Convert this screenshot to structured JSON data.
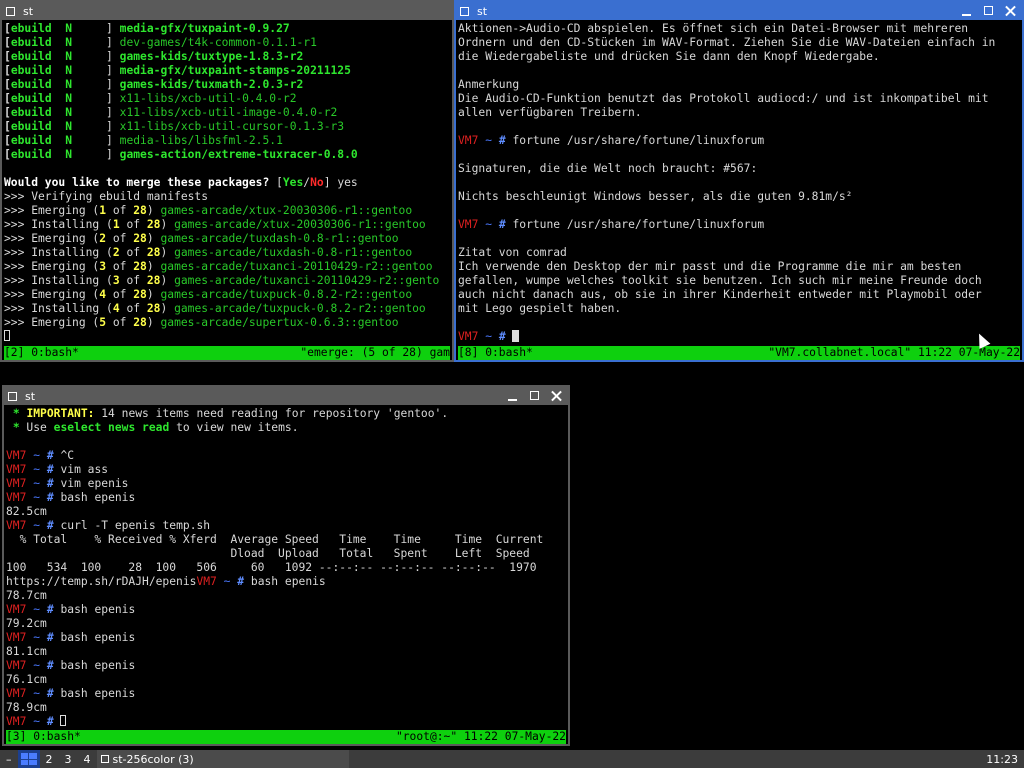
{
  "windows": {
    "emerge": {
      "title": "st",
      "status_left": "[2] 0:bash*",
      "status_right": "\"emerge: (5 of 28) gam"
    },
    "fortune": {
      "title": "st",
      "status_left": "[8] 0:bash*",
      "status_right": "\"VM7.collabnet.local\" 11:22 07-May-22"
    },
    "curl": {
      "title": "st",
      "status_left": "[3] 0:bash*",
      "status_right": "\"root@:~\" 11:22 07-May-22"
    }
  },
  "emerge_lines": [
    {
      "t": "ebuild",
      "f": "N",
      "pkg": "media-gfx/tuxpaint-0.9.27",
      "bold": true
    },
    {
      "t": "ebuild",
      "f": "N",
      "pkg": "dev-games/t4k-common-0.1.1-r1",
      "bold": false
    },
    {
      "t": "ebuild",
      "f": "N",
      "pkg": "games-kids/tuxtype-1.8.3-r2",
      "bold": true
    },
    {
      "t": "ebuild",
      "f": "N",
      "pkg": "media-gfx/tuxpaint-stamps-20211125",
      "bold": true
    },
    {
      "t": "ebuild",
      "f": "N",
      "pkg": "games-kids/tuxmath-2.0.3-r2",
      "bold": true
    },
    {
      "t": "ebuild",
      "f": "N",
      "pkg": "x11-libs/xcb-util-0.4.0-r2",
      "bold": false
    },
    {
      "t": "ebuild",
      "f": "N",
      "pkg": "x11-libs/xcb-util-image-0.4.0-r2",
      "bold": false
    },
    {
      "t": "ebuild",
      "f": "N",
      "pkg": "x11-libs/xcb-util-cursor-0.1.3-r3",
      "bold": false
    },
    {
      "t": "ebuild",
      "f": "N",
      "pkg": "media-libs/libsfml-2.5.1",
      "bold": false
    },
    {
      "t": "ebuild",
      "f": "N",
      "pkg": "games-action/extreme-tuxracer-0.8.0",
      "bold": true
    }
  ],
  "emerge_prompt": {
    "q": "Would you like to merge these packages?",
    "yes": "Yes",
    "no": "No",
    "answer": "yes"
  },
  "emerge_verify": ">>> Verifying ebuild manifests",
  "emerge_progress": [
    {
      "verb": "Emerging",
      "n": "1",
      "of": "28",
      "pkg": "games-arcade/xtux-20030306-r1::gentoo"
    },
    {
      "verb": "Installing",
      "n": "1",
      "of": "28",
      "pkg": "games-arcade/xtux-20030306-r1::gentoo"
    },
    {
      "verb": "Emerging",
      "n": "2",
      "of": "28",
      "pkg": "games-arcade/tuxdash-0.8-r1::gentoo"
    },
    {
      "verb": "Installing",
      "n": "2",
      "of": "28",
      "pkg": "games-arcade/tuxdash-0.8-r1::gentoo"
    },
    {
      "verb": "Emerging",
      "n": "3",
      "of": "28",
      "pkg": "games-arcade/tuxanci-20110429-r2::gentoo"
    },
    {
      "verb": "Installing",
      "n": "3",
      "of": "28",
      "pkg": "games-arcade/tuxanci-20110429-r2::gento"
    },
    {
      "verb": "Emerging",
      "n": "4",
      "of": "28",
      "pkg": "games-arcade/tuxpuck-0.8.2-r2::gentoo"
    },
    {
      "verb": "Installing",
      "n": "4",
      "of": "28",
      "pkg": "games-arcade/tuxpuck-0.8.2-r2::gentoo"
    },
    {
      "verb": "Emerging",
      "n": "5",
      "of": "28",
      "pkg": "games-arcade/supertux-0.6.3::gentoo"
    }
  ],
  "fortune": {
    "intro": [
      "Aktionen->Audio-CD abspielen. Es öffnet sich ein Datei-Browser mit mehreren",
      "Ordnern und den CD-Stücken im WAV-Format. Ziehen Sie die WAV-Dateien einfach in",
      "die Wiedergabeliste und drücken Sie dann den Knopf Wiedergabe.",
      "",
      "Anmerkung",
      "Die Audio-CD-Funktion benutzt das Protokoll audiocd:/ und ist inkompatibel mit",
      "allen verfügbaren Treibern."
    ],
    "host": "VM7",
    "tilde": "~",
    "hash": "#",
    "cmd": "fortune /usr/share/fortune/linuxforum",
    "out1": [
      "Signaturen, die die Welt noch braucht: #567:",
      "",
      "Nichts beschleunigt Windows besser, als die guten 9.81m/s²"
    ],
    "out2": [
      "Zitat von comrad",
      "Ich verwende den Desktop der mir passt und die Programme die mir am besten",
      "gefallen, wumpe welches toolkit sie benutzen. Ich such mir meine Freunde doch",
      "auch nicht danach aus, ob sie in ihrer Kinderheit entweder mit Playmobil oder",
      "mit Lego gespielt haben."
    ]
  },
  "curl": {
    "important_label": "IMPORTANT:",
    "important_text": " 14 news items need reading for repository 'gentoo'.",
    "use_text": "Use ",
    "eselect": "eselect news read",
    "use_tail": " to view new items.",
    "star": "*",
    "host": "VM7",
    "tilde": "~",
    "hash": "#",
    "cmds": [
      "^C",
      "vim ass",
      "vim epenis",
      "bash epenis"
    ],
    "out_825": "82.5cm",
    "curl_cmd": "curl -T epenis temp.sh",
    "hdr1": "  % Total    % Received % Xferd  Average Speed   Time    Time     Time  Current",
    "hdr2": "                                 Dload  Upload   Total   Spent    Left  Speed",
    "row": "100   534  100    28  100   506     60   1092 --:--:-- --:--:-- --:--:--  1970",
    "url": "https://temp.sh/rDAJH/epenis",
    "bash_cmd": "bash epenis",
    "results": [
      "78.7cm",
      "79.2cm",
      "81.1cm",
      "76.1cm",
      "78.9cm"
    ]
  },
  "taskbar": {
    "minus": "–",
    "ws": [
      "2",
      "3",
      "4"
    ],
    "task_label": "st-256color (3)",
    "clock": "11:23"
  }
}
